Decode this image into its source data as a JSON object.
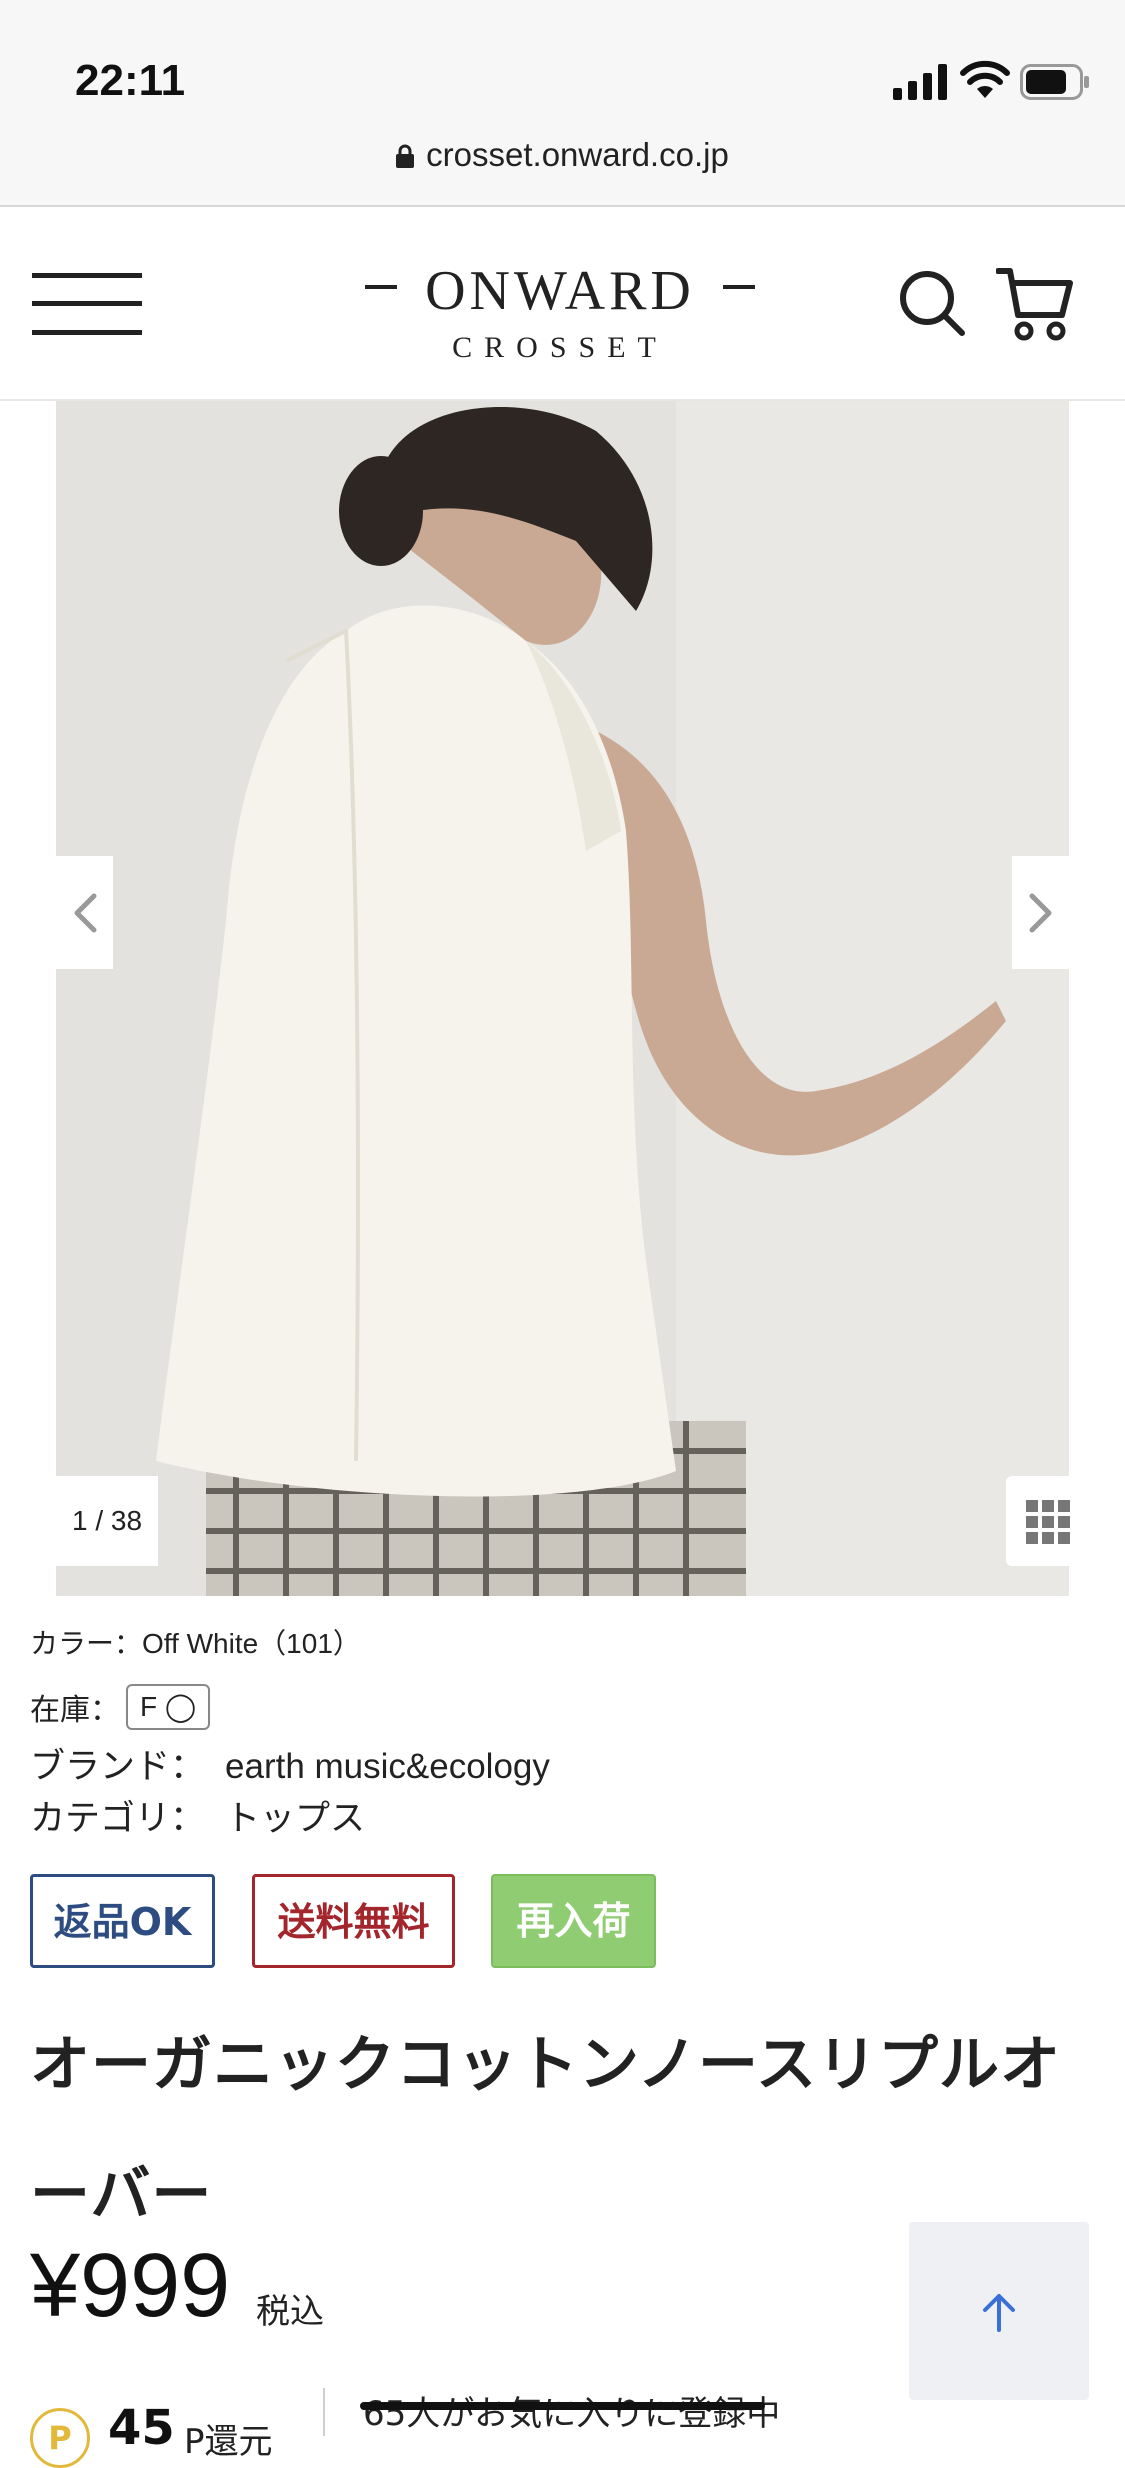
{
  "status_bar": {
    "time": "22:11",
    "url": "crosset.onward.co.jp"
  },
  "header": {
    "logo_main": "ONWARD",
    "logo_sub": "CROSSET"
  },
  "carousel": {
    "counter": "1 / 38"
  },
  "details": {
    "color": "カラー：Off White（101）",
    "stock_label": "在庫：",
    "stock_value": "F ◯",
    "brand_label": "ブランド：",
    "brand_value": "earth music&ecology",
    "category_label": "カテゴリ：",
    "category_value": "トップス"
  },
  "badges": {
    "return": "返品OK",
    "shipping": "送料無料",
    "restock": "再入荷"
  },
  "product": {
    "title": "オーガニックコットンノースリプルオーバー",
    "price": "¥999",
    "tax": "税込"
  },
  "points": {
    "coin": "P",
    "value": "45",
    "label": "P還元"
  },
  "favorites": {
    "text": "65人がお気に入りに登録中"
  },
  "colors": {
    "return": "#2c4c82",
    "shipping": "#a3262d",
    "restock": "#8fcc72",
    "coin": "#e2b93b",
    "top_arrow": "#3b6fd8"
  }
}
